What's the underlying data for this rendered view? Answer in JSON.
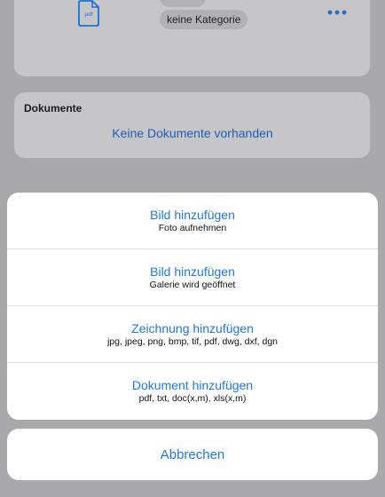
{
  "background": {
    "item": {
      "file_icon": "pdf-file-icon",
      "file_icon_label": "pdf",
      "category_label": "keine Kategorie",
      "more_icon": "ellipsis-icon"
    },
    "documents": {
      "title": "Dokumente",
      "empty_text": "Keine Dokumente vorhanden"
    }
  },
  "action_sheet": {
    "options": [
      {
        "title": "Bild hinzufügen",
        "subtitle": "Foto aufnehmen"
      },
      {
        "title": "Bild hinzufügen",
        "subtitle": "Galerie wird geöffnet"
      },
      {
        "title": "Zeichnung hinzufügen",
        "subtitle": "jpg, jpeg, png, bmp, tif, pdf, dwg, dxf, dgn"
      },
      {
        "title": "Dokument hinzufügen",
        "subtitle": "pdf, txt, doc(x,m), xls(x,m)"
      }
    ],
    "cancel_label": "Abbrechen"
  },
  "colors": {
    "accent": "#1f7ae0",
    "overlay": "#a9a9ac"
  }
}
